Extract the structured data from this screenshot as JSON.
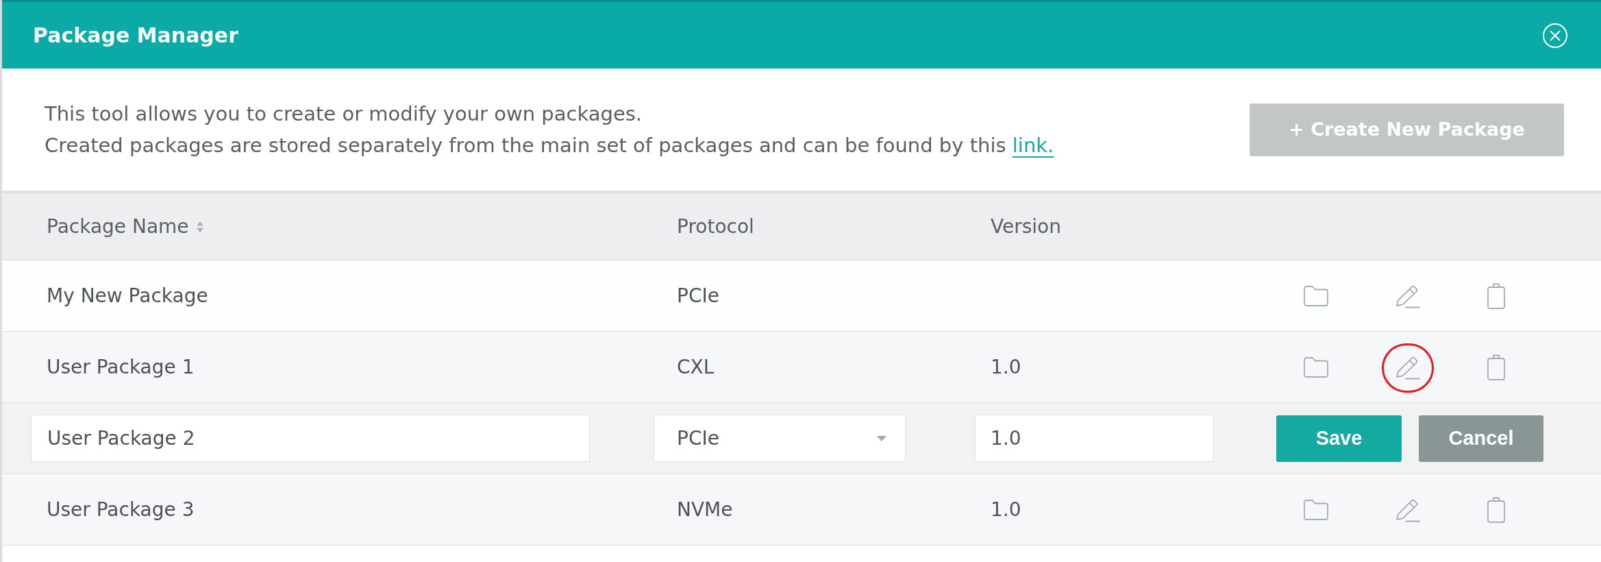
{
  "window": {
    "title": "Package Manager"
  },
  "intro": {
    "lines": [
      "This tool allows you to create or modify your own packages.",
      "Created packages are stored separately from the main set of packages and can be found by this"
    ],
    "link": "link."
  },
  "create_button": {
    "label": "+ Create New Package",
    "disabled": true
  },
  "table": {
    "columns": [
      {
        "label": "Package Name",
        "sortable": true
      },
      {
        "label": "Protocol",
        "sortable": false
      },
      {
        "label": "Version",
        "sortable": false
      }
    ],
    "rows": [
      {
        "kind": "view",
        "name": "My New Package",
        "protocol": "PCIe",
        "edit_highlighted": false
      },
      {
        "kind": "view",
        "name": "User Package 1",
        "protocol": "CXL",
        "version": "1.0",
        "edit_highlighted": true
      },
      {
        "kind": "edit",
        "name": "User Package 2",
        "protocol": "PCIe",
        "version": "1.0",
        "save": "Save",
        "cancel": "Cancel"
      },
      {
        "kind": "view",
        "name": "User Package 3",
        "protocol": "NVMe",
        "version": "1.0",
        "edit_highlighted": false
      }
    ]
  }
}
